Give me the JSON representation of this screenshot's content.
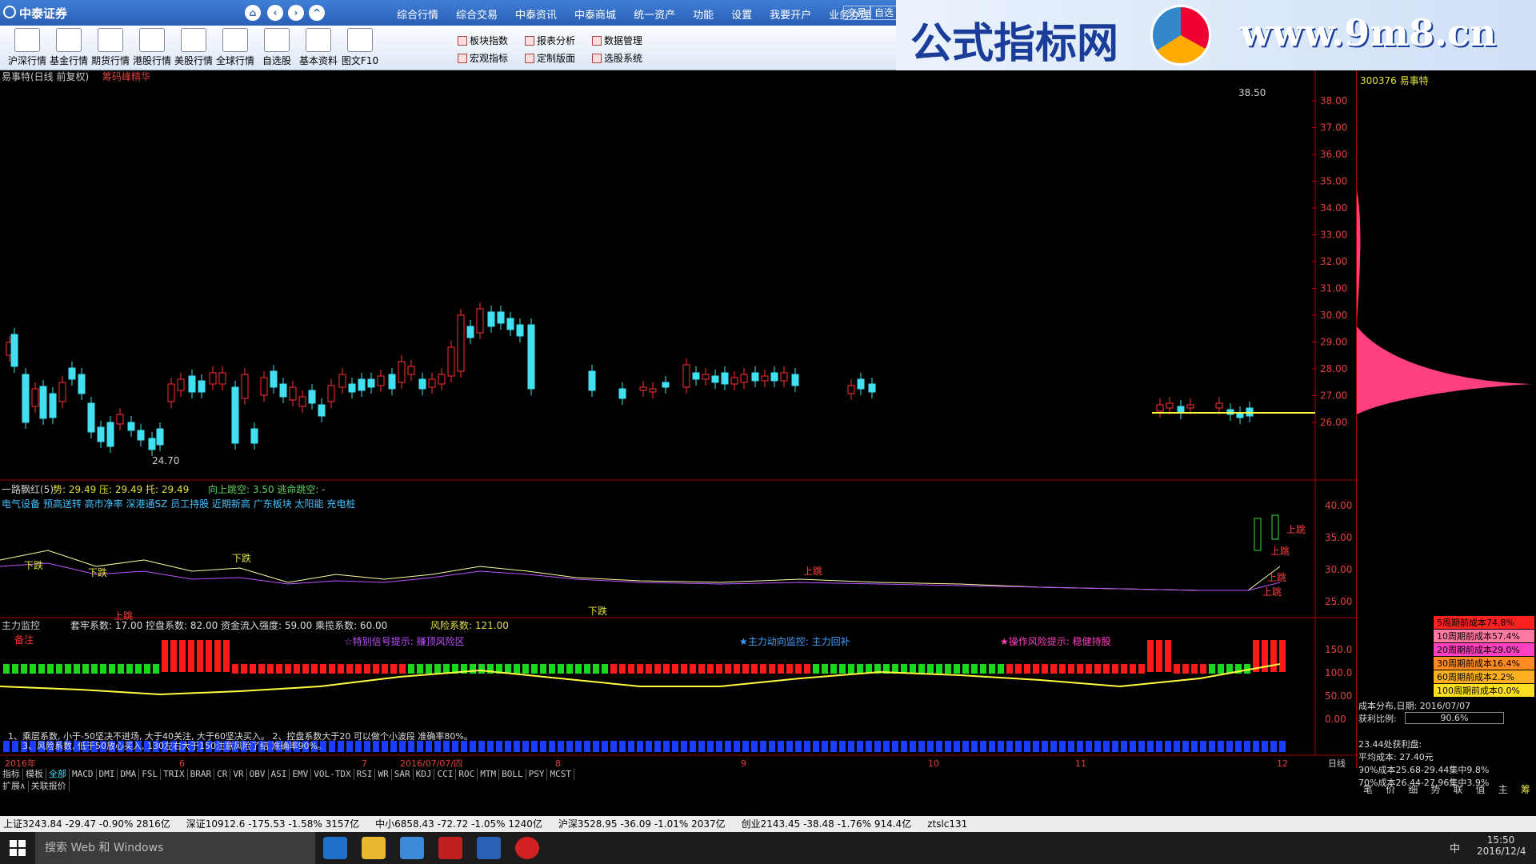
{
  "titlebar": {
    "app_name": "中泰证券",
    "menu": [
      "综合行情",
      "综合交易",
      "中泰资讯",
      "中泰商城",
      "统一资产",
      "功能",
      "设置",
      "我要开户",
      "业务办理"
    ],
    "buttons": [
      "交易",
      "自选"
    ]
  },
  "toolbar": {
    "items": [
      "沪深行情",
      "基金行情",
      "期货行情",
      "港股行情",
      "美股行情",
      "全球行情",
      "自选股",
      "基本资料",
      "图文F10"
    ],
    "small": [
      "板块指数",
      "宏观指标",
      "报表分析",
      "定制版面",
      "数据管理",
      "选股系统"
    ]
  },
  "ad": {
    "cn": "公式指标网",
    "url": "www.9m8.cn"
  },
  "main_chart": {
    "title": "易事特(日线 前复权)",
    "indicator": "筹码峰精华",
    "prices": [
      "38.00",
      "37.00",
      "36.00",
      "35.00",
      "34.00",
      "33.00",
      "32.00",
      "31.00",
      "30.00",
      "29.00",
      "28.00",
      "27.00",
      "26.00"
    ],
    "max_label": "38.50",
    "min_label": "24.70"
  },
  "mid_chart": {
    "title": "一路飘红(5)",
    "line1": "势: 29.49  压: 29.49  托: 29.49",
    "jump": "向上跳空: 3.50  逃命跳空: -",
    "tags": "电气设备 预高送转 高市净率 深港通SZ 员工持股 近期新高 广东板块 太阳能 充电桩",
    "scale": [
      "40.00",
      "35.00",
      "30.00",
      "25.00"
    ],
    "marks": [
      "下跌",
      "下跌",
      "下跌",
      "上跳",
      "上跳",
      "下跌",
      "上跳",
      "上跳",
      "上跳",
      "上跳"
    ]
  },
  "bottom_chart": {
    "title": "主力监控",
    "params": "套牢系数: 17.00  控盘系数: 82.00  资金流入强度: 59.00  乘揽系数: 60.00",
    "risk": "风险系数: 121.00",
    "note": "备注",
    "sig1": "☆特别信号提示: 赚顶风险区",
    "sig2": "★主力动向监控: 主力回补",
    "sig3": "★操作风险提示: 稳健持股",
    "scale": [
      "150.0",
      "100.0",
      "50.00",
      "0.00"
    ],
    "desc1": "1、乘层系数, 小于-50坚决不进场, 大于40关注, 大于60坚决买入。    2、控盘系数大于20 可以做个小波段 准确率80%。",
    "desc2": "3、风险系数, 低于50放心买入, 130左右大于150注意风险了结 准确率90%。"
  },
  "xaxis": {
    "labels": [
      "2016年",
      "6",
      "7",
      "2016/07/07/四",
      "8",
      "9",
      "10",
      "11",
      "12"
    ],
    "right": "日线"
  },
  "tabs": [
    "指标",
    "模板",
    "全部",
    "MACD",
    "DMI",
    "DMA",
    "FSL",
    "TRIX",
    "BRAR",
    "CR",
    "VR",
    "OBV",
    "ASI",
    "EMV",
    "VOL-TDX",
    "RSI",
    "WR",
    "SAR",
    "KDJ",
    "CCI",
    "ROC",
    "MTM",
    "BOLL",
    "PSY",
    "MCST"
  ],
  "tabs2": [
    "扩展∧",
    "关联报价"
  ],
  "right_panel": {
    "code": "300376 易事特",
    "cost_rows": [
      "5周期前成本74.8%",
      "10周期前成本57.4%",
      "20周期前成本29.0%",
      "30周期前成本16.4%",
      "60周期前成本2.2%",
      "100周期前成本0.0%"
    ],
    "cost_colors": [
      "#ff2020",
      "#ff7aa0",
      "#ff40c0",
      "#ff8a20",
      "#ffb020",
      "#ffe020"
    ],
    "info": [
      "成本分布,日期: 2016/07/07",
      "获利比例:",
      "90.6%",
      "23.44处获利盘:",
      "平均成本: 27.40元",
      "90%成本25.68-29.44集中9.8%",
      "70%成本26.44-27.96集中3.9%"
    ],
    "tabs": [
      "笔",
      "价",
      "细",
      "势",
      "联",
      "值",
      "主",
      "筹"
    ]
  },
  "status": [
    "上证3243.84 -29.47 -0.90% 2816亿",
    "深证10912.6 -175.53 -1.58% 3157亿",
    "中小6858.43 -72.72 -1.05% 1240亿",
    "沪深3528.95 -36.09 -1.01% 2037亿",
    "创业2143.45 -38.48 -1.76% 914.4亿",
    "ztslc131"
  ],
  "taskbar": {
    "search": "搜索 Web 和 Windows",
    "time": "15:50",
    "date": "2016/12/4",
    "ime": "中"
  }
}
